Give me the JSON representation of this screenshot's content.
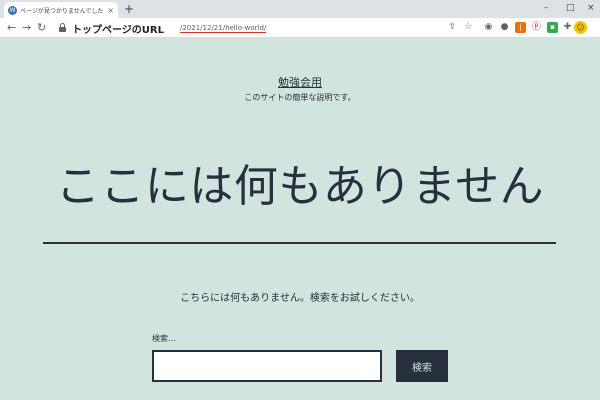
{
  "browser": {
    "tab_title": "ページが見つかりませんでした – 勉強",
    "tab_close": "×",
    "new_tab": "+",
    "window_controls": [
      "–",
      "□",
      "×"
    ],
    "favicon_letter": "W",
    "url_annotation": "トップページのURL",
    "url_path": "/2021/12/21/hello-world/",
    "nav": {
      "back": "←",
      "forward": "→",
      "reload": "↻"
    }
  },
  "site": {
    "title": "勉強会用",
    "description": "このサイトの簡単な説明です。"
  },
  "main": {
    "heading": "ここには何もありません",
    "message": "こちらには何もありません。検索をお試しください。",
    "search_label": "検索…",
    "search_value": "",
    "search_button": "検索"
  },
  "colors": {
    "page_background": "#d1e4dd",
    "text": "#28303d",
    "url_underline": "#d93025"
  }
}
